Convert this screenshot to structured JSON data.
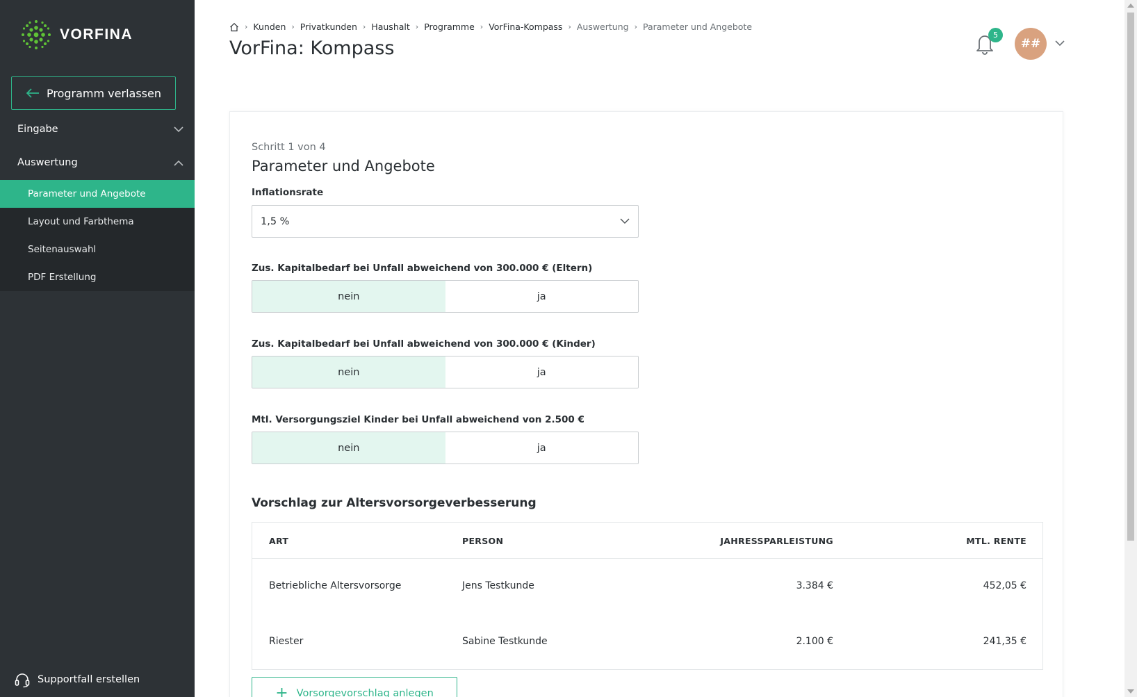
{
  "brand": {
    "name": "VORFINA"
  },
  "sidebar": {
    "leave_label": "Programm verlassen",
    "sections": [
      {
        "label": "Eingabe",
        "expanded": false
      },
      {
        "label": "Auswertung",
        "expanded": true
      }
    ],
    "subitems": [
      {
        "label": "Parameter und Angebote",
        "active": true
      },
      {
        "label": "Layout und Farbthema",
        "active": false
      },
      {
        "label": "Seitenauswahl",
        "active": false
      },
      {
        "label": "PDF Erstellung",
        "active": false
      }
    ],
    "support_label": "Supportfall erstellen"
  },
  "header": {
    "breadcrumb": [
      "Kunden",
      "Privatkunden",
      "Haushalt",
      "Programme",
      "VorFina-Kompass",
      "Auswertung",
      "Parameter und Angebote"
    ],
    "title": "VorFina: Kompass",
    "notification_count": "5",
    "avatar_initials": "##"
  },
  "main": {
    "step": "Schritt 1 von 4",
    "title": "Parameter und Angebote",
    "inflation": {
      "label": "Inflationsrate",
      "value": "1,5 %"
    },
    "toggles": [
      {
        "label": "Zus. Kapitalbedarf bei Unfall abweichend von 300.000 € (Eltern)",
        "options": [
          "nein",
          "ja"
        ],
        "selected": "nein"
      },
      {
        "label": "Zus. Kapitalbedarf bei Unfall abweichend von 300.000 € (Kinder)",
        "options": [
          "nein",
          "ja"
        ],
        "selected": "nein"
      },
      {
        "label": "Mtl. Versorgungsziel Kinder bei Unfall abweichend von 2.500 €",
        "options": [
          "nein",
          "ja"
        ],
        "selected": "nein"
      }
    ],
    "proposal": {
      "title": "Vorschlag zur Altersvorsorgeverbesserung",
      "columns": [
        "ART",
        "PERSON",
        "JAHRESSPARLEISTUNG",
        "MTL. RENTE"
      ],
      "rows": [
        [
          "Betriebliche Altersvorsorge",
          "Jens Testkunde",
          "3.384 €",
          "452,05 €"
        ],
        [
          "Riester",
          "Sabine Testkunde",
          "2.100 €",
          "241,35 €"
        ]
      ],
      "add_label": "Vorsorgevorschlag anlegen"
    }
  },
  "colors": {
    "accent": "#2eb58a",
    "sidebar": "#2d3236",
    "selected_bg": "#e3f6ef",
    "avatar": "#d9a27f"
  }
}
